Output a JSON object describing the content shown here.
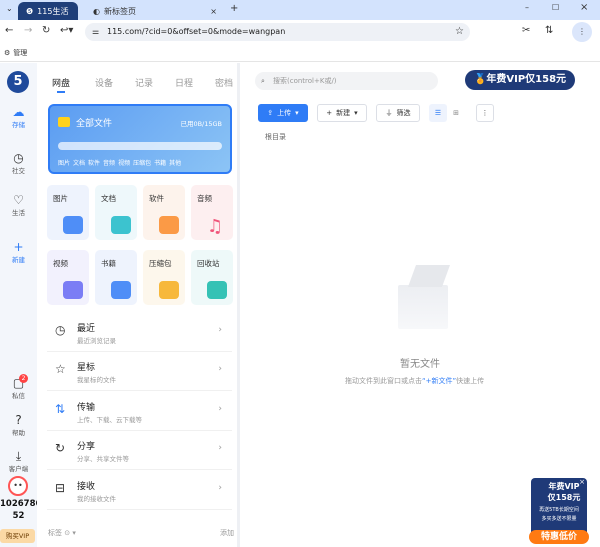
{
  "browser": {
    "tabs": [
      {
        "label": "115生活",
        "active": true
      },
      {
        "label": "新标签页",
        "active": false
      }
    ],
    "url": "115.com/?cid=0&offset=0&mode=wangpan",
    "bookmark": "管理"
  },
  "rail": {
    "items": [
      {
        "label": "存储",
        "icon": "cloud-icon"
      },
      {
        "label": "社交",
        "icon": "clock-icon"
      },
      {
        "label": "生活",
        "icon": "heart-icon"
      },
      {
        "label": "新建",
        "icon": "plus-icon"
      },
      {
        "label": "私信",
        "icon": "chat-icon",
        "badge": "2"
      },
      {
        "label": "帮助",
        "icon": "help-icon"
      },
      {
        "label": "客户端",
        "icon": "download-icon"
      }
    ],
    "user_id_line1": "1026786",
    "user_id_line2": "52",
    "buy_vip": "购买VIP"
  },
  "nav_tabs": [
    "网盘",
    "设备",
    "记录",
    "日程",
    "密档"
  ],
  "search": {
    "placeholder": "搜索(control+K或/)"
  },
  "vip_banner": "年费VIP仅158元",
  "storage_card": {
    "title": "全部文件",
    "usage": "已用0B/15GB",
    "usage_fraction": 0,
    "legend": [
      "图片",
      "文档",
      "软件",
      "音频",
      "视频",
      "压缩包",
      "书籍",
      "其他"
    ]
  },
  "tiles": [
    "图片",
    "文档",
    "软件",
    "音频",
    "视频",
    "书籍",
    "压缩包",
    "回收站"
  ],
  "menu": [
    {
      "title": "最近",
      "sub": "最近浏览记录",
      "icon": "history-icon"
    },
    {
      "title": "星标",
      "sub": "我星标的文件",
      "icon": "star-icon"
    },
    {
      "title": "传输",
      "sub": "上传、下载、云下载等",
      "icon": "transfer-icon"
    },
    {
      "title": "分享",
      "sub": "分享、共享文件等",
      "icon": "share-icon"
    },
    {
      "title": "接收",
      "sub": "我的接收文件",
      "icon": "inbox-icon"
    }
  ],
  "tags": {
    "label": "标签",
    "add": "添加"
  },
  "toolbar": {
    "upload": "上传",
    "new": "新建",
    "filter": "筛选"
  },
  "breadcrumb": "根目录",
  "empty": {
    "title": "暂无文件",
    "hint_pre": "拖动文件到此窗口或点击",
    "hint_link": "“+新文件”",
    "hint_post": "快速上传"
  },
  "ad": {
    "line1": "年费VIP",
    "line2": "仅158元",
    "line3": "再送5TB长期空间",
    "line4": "多买多送不限量",
    "cta": "特惠低价"
  }
}
